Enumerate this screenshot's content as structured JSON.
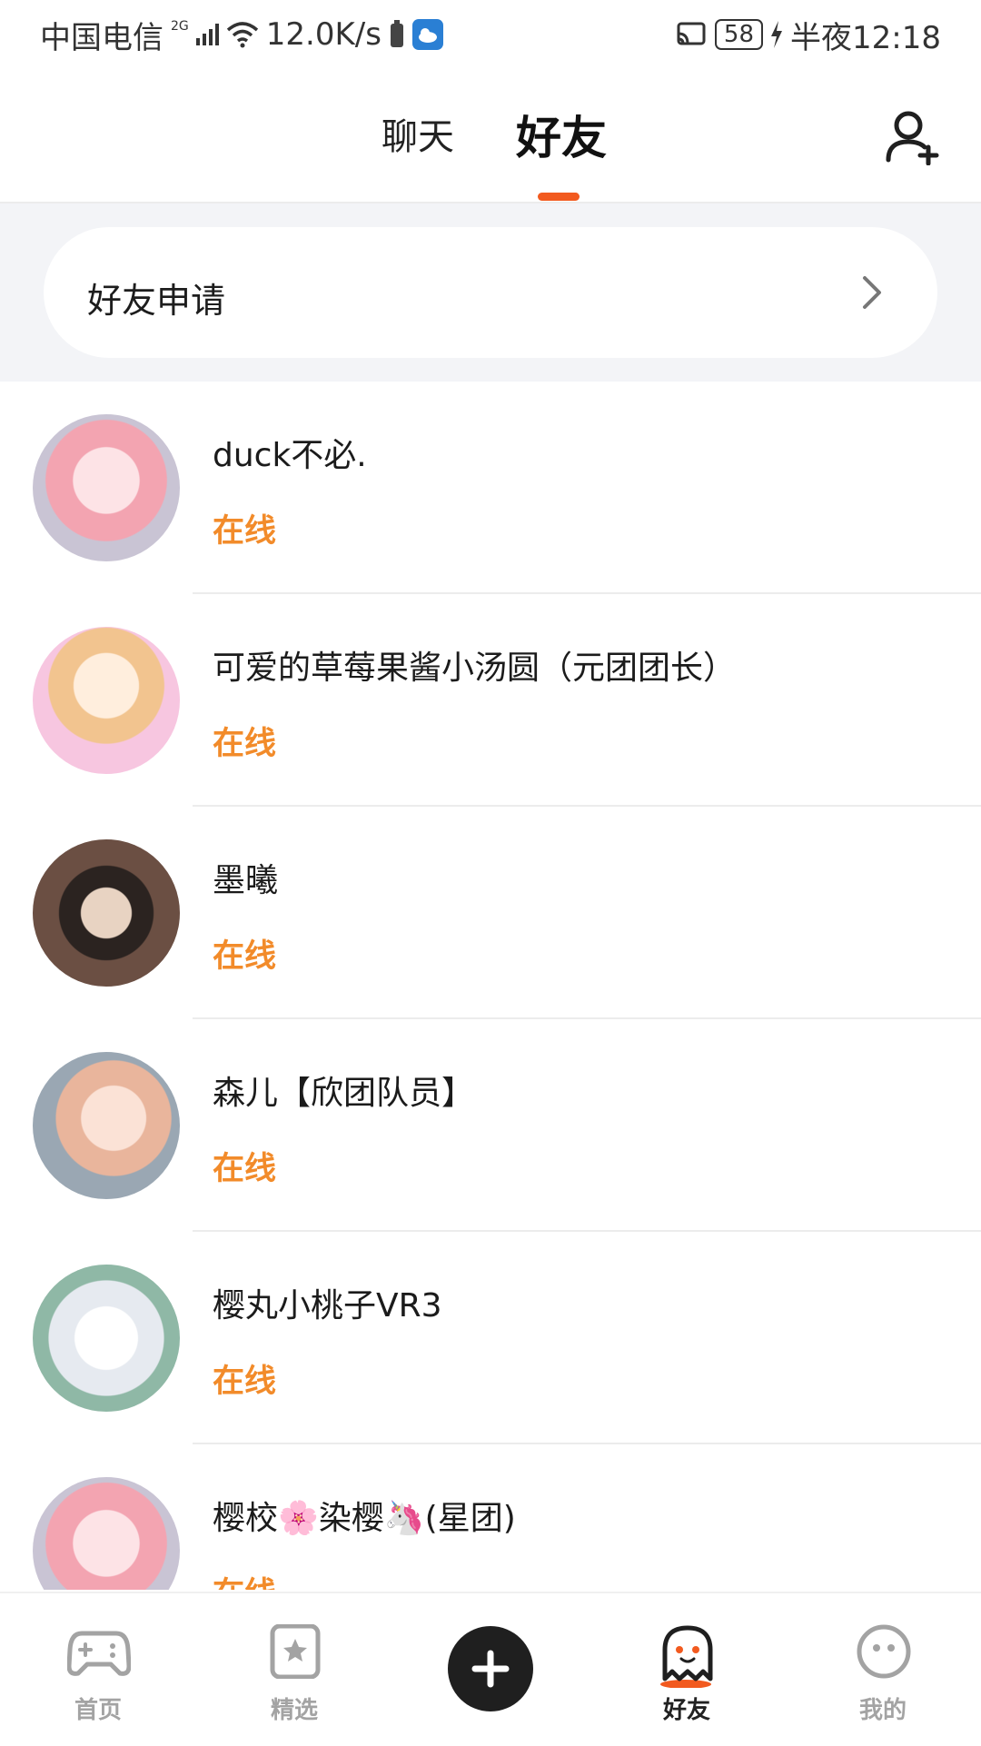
{
  "status_bar": {
    "carrier": "中国电信",
    "network": "2G",
    "speed": "12.0K/s",
    "battery": "58",
    "time_label": "半夜12:18"
  },
  "header": {
    "tab_chat": "聊天",
    "tab_friends": "好友",
    "active_tab": "好友",
    "accent_color": "#f25a1f"
  },
  "friend_request": {
    "label": "好友申请"
  },
  "friends": [
    {
      "name": "duck不必.",
      "status": "在线"
    },
    {
      "name": "可爱的草莓果酱小汤圆（元团团长）",
      "status": "在线"
    },
    {
      "name": "墨曦",
      "status": "在线"
    },
    {
      "name": "森儿【欣团队员】",
      "status": "在线"
    },
    {
      "name": "樱丸小桃子VR3",
      "status": "在线"
    },
    {
      "name": "樱校🌸染樱🦄(星团)",
      "status": "在线"
    }
  ],
  "bottom_nav": {
    "home": "首页",
    "featured": "精选",
    "friends": "好友",
    "me": "我的",
    "active": "好友"
  },
  "colors": {
    "online": "#f28b2a",
    "band_bg": "#f3f4f7",
    "fab_bg": "#1f1f1f"
  }
}
